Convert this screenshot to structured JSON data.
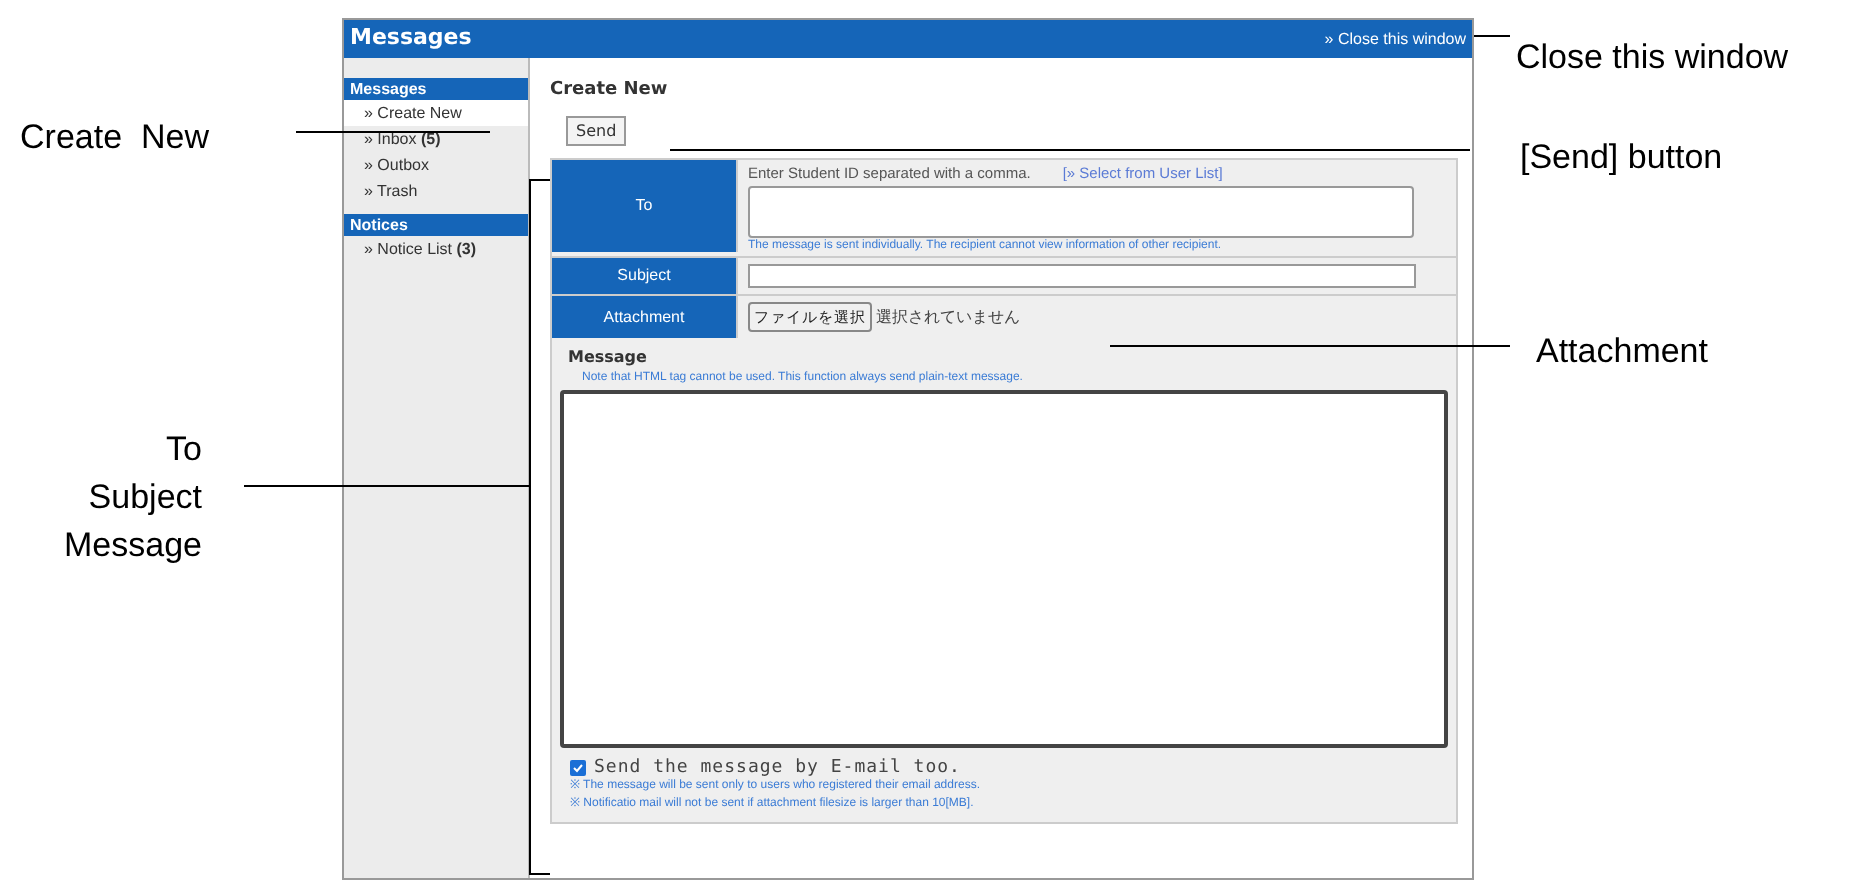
{
  "window": {
    "title": "Messages",
    "close_link": "» Close this window"
  },
  "sidebar": {
    "sections": [
      {
        "title": "Messages",
        "items": [
          {
            "label": "» Create New",
            "selected": true
          },
          {
            "label": "» Inbox **(5)**",
            "selected": false
          },
          {
            "label": "» Outbox",
            "selected": false
          },
          {
            "label": "» Trash",
            "selected": false
          }
        ]
      },
      {
        "title": "Notices",
        "items": [
          {
            "label": "» Notice List **(3)**",
            "selected": false
          }
        ]
      }
    ]
  },
  "page_heading": "Create New",
  "send_button": "Send",
  "form": {
    "to": {
      "label": "To",
      "hint": "Enter Student ID separated with a comma.",
      "link": "[» Select from User List]",
      "note": "The message is sent individually. The recipient cannot view information of other recipient."
    },
    "subject": {
      "label": "Subject"
    },
    "attachment": {
      "label": "Attachment",
      "button": "ファイルを選択",
      "status": "選択されていません"
    },
    "message": {
      "label": "Message",
      "note": "Note that HTML tag cannot be used. This function always send plain-text message."
    },
    "email_option": {
      "label": "Send the message by E-mail too.",
      "checked": true
    },
    "notes": [
      "※ The message will be sent only to users who registered their email address.",
      "※ Notificatio mail will not be sent if attachment filesize is larger than 10[MB]."
    ]
  },
  "annotations": [
    "Close this window",
    "Create  New",
    "[Send] button",
    "Attachment",
    "To\nSubject\nMessage"
  ]
}
